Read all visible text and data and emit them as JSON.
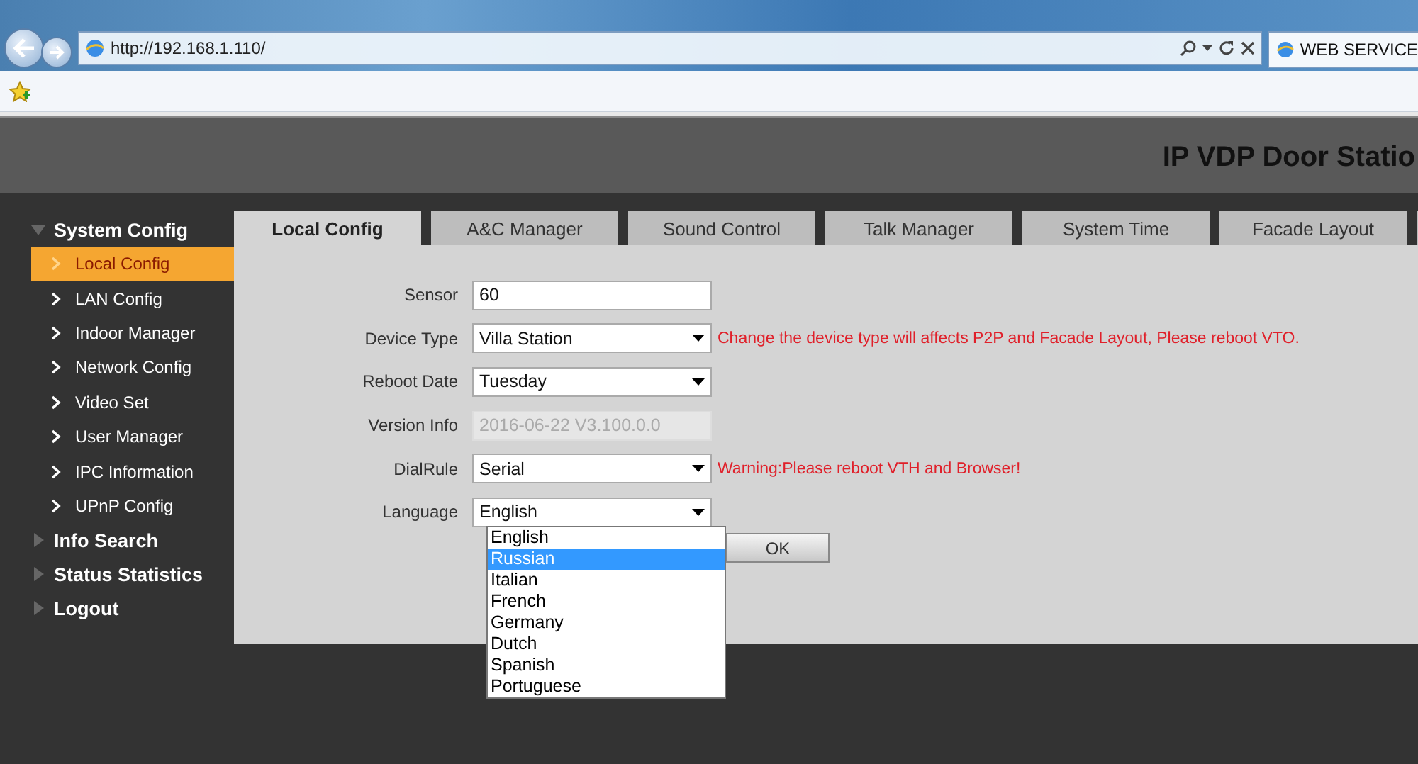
{
  "browser": {
    "address": "http://192.168.1.110/",
    "tab": "WEB SERVICE"
  },
  "header": {
    "title": "IP VDP Door Statio"
  },
  "sidebar": {
    "sections": [
      {
        "label": "System Config",
        "expanded": true,
        "items": [
          {
            "label": "Local Config",
            "selected": true
          },
          {
            "label": "LAN Config",
            "selected": false
          },
          {
            "label": "Indoor Manager",
            "selected": false
          },
          {
            "label": "Network Config",
            "selected": false
          },
          {
            "label": "Video Set",
            "selected": false
          },
          {
            "label": "User Manager",
            "selected": false
          },
          {
            "label": "IPC Information",
            "selected": false
          },
          {
            "label": "UPnP Config",
            "selected": false
          }
        ]
      },
      {
        "label": "Info Search",
        "expanded": false
      },
      {
        "label": "Status Statistics",
        "expanded": false
      },
      {
        "label": "Logout",
        "expanded": false
      }
    ]
  },
  "tabs": [
    {
      "label": "Local Config",
      "selected": true
    },
    {
      "label": "A&C Manager",
      "selected": false
    },
    {
      "label": "Sound Control",
      "selected": false
    },
    {
      "label": "Talk Manager",
      "selected": false
    },
    {
      "label": "System Time",
      "selected": false
    },
    {
      "label": "Facade Layout",
      "selected": false
    }
  ],
  "form": {
    "fields": [
      {
        "label": "Sensor",
        "kind": "text",
        "value": "60"
      },
      {
        "label": "Device Type",
        "kind": "select",
        "value": "Villa Station",
        "note": "Change the device type will affects P2P and Facade Layout, Please reboot VTO."
      },
      {
        "label": "Reboot Date",
        "kind": "select",
        "value": "Tuesday"
      },
      {
        "label": "Version Info",
        "kind": "readonly",
        "value": "2016-06-22 V3.100.0.0"
      },
      {
        "label": "DialRule",
        "kind": "select",
        "value": "Serial",
        "note": "Warning:Please reboot VTH and Browser!"
      },
      {
        "label": "Language",
        "kind": "select",
        "value": "English",
        "options": [
          {
            "label": "English",
            "highlighted": false
          },
          {
            "label": "Russian",
            "highlighted": true
          },
          {
            "label": "Italian",
            "highlighted": false
          },
          {
            "label": "French",
            "highlighted": false
          },
          {
            "label": "Germany",
            "highlighted": false
          },
          {
            "label": "Dutch",
            "highlighted": false
          },
          {
            "label": "Spanish",
            "highlighted": false
          },
          {
            "label": "Portuguese",
            "highlighted": false
          }
        ]
      }
    ],
    "ok_button": "OK"
  }
}
